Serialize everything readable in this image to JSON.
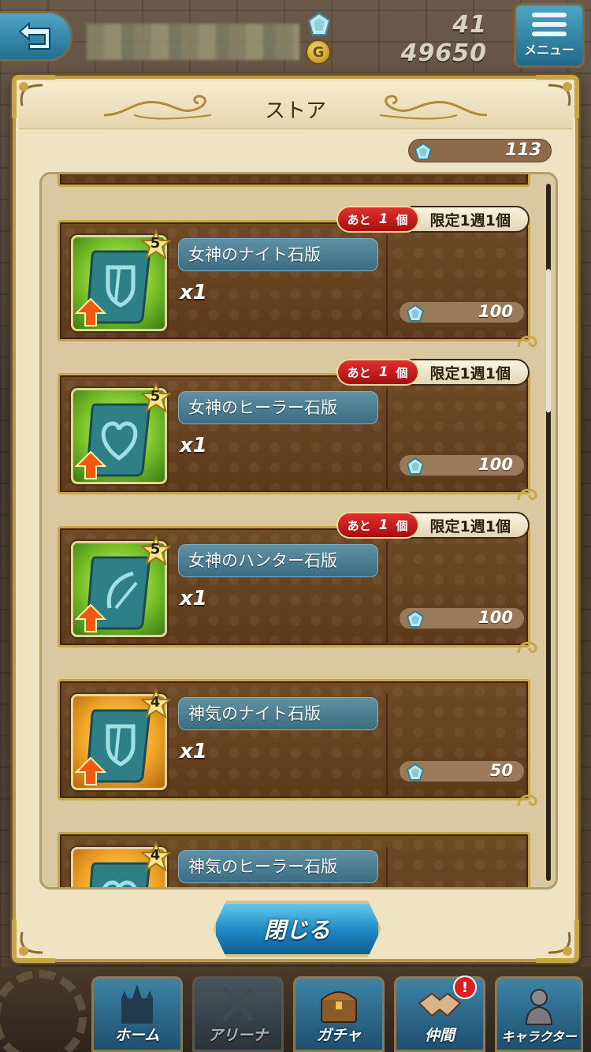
{
  "topbar": {
    "gem_count": "41",
    "gold_count": "49650",
    "menu_label": "メニュー"
  },
  "dialog": {
    "title": "ストア",
    "gem_balance": "113",
    "close_label": "閉じる"
  },
  "items": [
    {
      "name": "女神のナイト石版",
      "quantity": "x1",
      "price": "100",
      "rarity": "5",
      "frame_color": "green",
      "symbol": "shield",
      "remain_prefix": "あと",
      "remain_count": "1",
      "remain_suffix": "個",
      "limit": "限定1週1個"
    },
    {
      "name": "女神のヒーラー石版",
      "quantity": "x1",
      "price": "100",
      "rarity": "5",
      "frame_color": "green",
      "symbol": "heart",
      "remain_prefix": "あと",
      "remain_count": "1",
      "remain_suffix": "個",
      "limit": "限定1週1個"
    },
    {
      "name": "女神のハンター石版",
      "quantity": "x1",
      "price": "100",
      "rarity": "5",
      "frame_color": "green",
      "symbol": "bow",
      "remain_prefix": "あと",
      "remain_count": "1",
      "remain_suffix": "個",
      "limit": "限定1週1個"
    },
    {
      "name": "神気のナイト石版",
      "quantity": "x1",
      "price": "50",
      "rarity": "4",
      "frame_color": "orange",
      "symbol": "shield"
    },
    {
      "name": "神気のヒーラー石版",
      "rarity": "4",
      "frame_color": "orange",
      "symbol": "heart"
    }
  ],
  "bottom_nav": [
    {
      "label": "ホーム",
      "icon": "castle-icon"
    },
    {
      "label": "アリーナ",
      "icon": "crossed-swords-icon"
    },
    {
      "label": "ガチャ",
      "icon": "treasure-chest-icon"
    },
    {
      "label": "仲間",
      "icon": "handshake-icon",
      "badge": "!"
    },
    {
      "label": "キャラクター",
      "icon": "knight-icon"
    }
  ],
  "colors": {
    "accent_blue": "#3d6d82",
    "limit_red": "#c01818",
    "card_brown": "#5c3a1a",
    "gold_border": "#c9a54a"
  }
}
